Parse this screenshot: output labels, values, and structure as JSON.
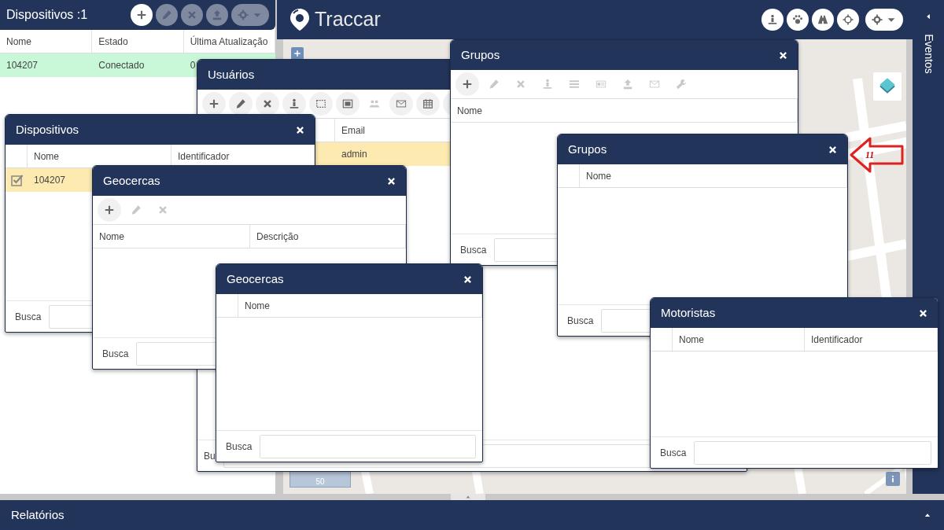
{
  "device_panel": {
    "title": "Dispositivos :1",
    "tools": [
      {
        "disabled": false
      },
      {
        "disabled": true
      },
      {
        "disabled": true
      },
      {
        "disabled": true
      },
      {
        "disabled": true
      }
    ],
    "columns": [
      "Nome",
      "Estado",
      "Última Atualização"
    ],
    "rows": [
      {
        "cells": [
          "104207",
          "Conectado",
          "0"
        ],
        "color": "#c8f8d8"
      }
    ]
  },
  "map": {
    "brand": "Traccar",
    "scale_label": "50"
  },
  "events_panel": {
    "title": "Eventos"
  },
  "reports_panel": {
    "title": "Relatórios"
  },
  "windows": [
    {
      "title": "Usuários",
      "tools": [
        {
          "disabled": false
        },
        {
          "disabled": false
        },
        {
          "disabled": false
        },
        {
          "disabled": false
        },
        {
          "disabled": false
        },
        {
          "disabled": false
        },
        {
          "disabled": true
        },
        {
          "disabled": false
        },
        {
          "disabled": false
        },
        {
          "disabled": false
        }
      ],
      "columns": [
        "Email"
      ],
      "rows": [
        {
          "cells": [
            "admin"
          ],
          "selected": true
        }
      ],
      "search": {
        "label": "Bu"
      }
    },
    {
      "title": "Grupos",
      "tools": [
        {
          "disabled": false
        },
        {
          "disabled": true
        },
        {
          "disabled": true
        },
        {
          "disabled": true
        },
        {
          "disabled": true
        },
        {
          "disabled": true
        },
        {
          "disabled": true
        },
        {
          "disabled": true
        },
        {
          "disabled": true
        }
      ],
      "columns": [
        "Nome"
      ],
      "search": {
        "label": "Busca"
      }
    },
    {
      "title": "Dispositivos",
      "columns": [
        "Nome",
        "Identificador"
      ],
      "rows": [
        {
          "cells": [
            "104207"
          ],
          "selected": true,
          "checked": true
        }
      ],
      "search": {
        "label": "Busca"
      }
    },
    {
      "title": "Geocercas",
      "tools": [
        {
          "disabled": false
        },
        {
          "disabled": true
        },
        {
          "disabled": true
        }
      ],
      "columns": [
        "Nome",
        "Descrição"
      ],
      "search": {
        "label": "Busca"
      }
    },
    {
      "title": "Grupos",
      "columns": [
        "Nome"
      ],
      "search": {
        "label": "Busca"
      }
    },
    {
      "title": "Geocercas",
      "columns": [
        "Nome"
      ],
      "search": {
        "label": "Busca"
      }
    },
    {
      "title": "Motoristas",
      "columns": [
        "Nome",
        "Identificador"
      ],
      "search": {
        "label": "Busca"
      }
    }
  ],
  "annotation": {
    "label": "11"
  }
}
